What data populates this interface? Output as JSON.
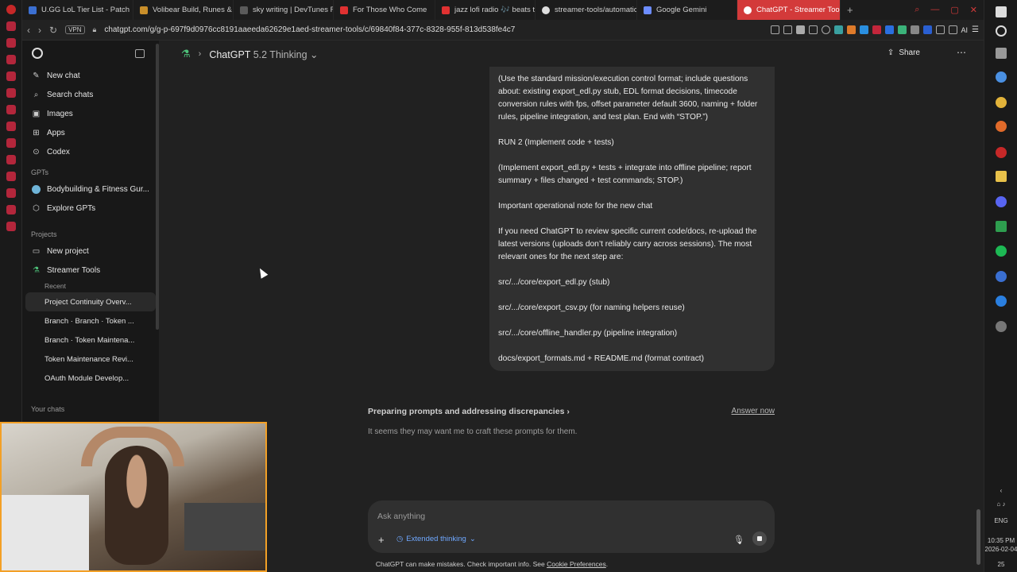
{
  "browser": {
    "tabs": [
      {
        "title": "U.GG LoL Tier List - Patch",
        "color": "#3b6fd1"
      },
      {
        "title": "Volibear Build, Runes & Co",
        "color": "#c98f2a"
      },
      {
        "title": "sky writing | DevTunes FM",
        "color": "#5a5a5a"
      },
      {
        "title": "For Those Who Come",
        "color": "#e03131"
      },
      {
        "title": "jazz lofi radio 🎶 beats to",
        "color": "#e03131"
      },
      {
        "title": "streamer-tools/automatic",
        "color": "#dddddd"
      },
      {
        "title": "Google Gemini",
        "color": "#6c8cff"
      },
      {
        "title": "ChatGPT - Streamer Tools",
        "color": "#ffffff",
        "active": true
      }
    ],
    "vpn_label": "VPN",
    "url": "chatgpt.com/g/g-p-697f9d0976cc8191aaeeda62629e1aed-streamer-tools/c/69840f84-377c-8328-955f-813d538fe4c7",
    "ai_label": "AI",
    "tray": {
      "lang": "ENG",
      "time": "10:35 PM",
      "date": "2026-02-04",
      "badge": "25"
    }
  },
  "sidebar": {
    "top_items": [
      {
        "label": "New chat",
        "icon": "pencil-icon"
      },
      {
        "label": "Search chats",
        "icon": "search-icon"
      },
      {
        "label": "Images",
        "icon": "image-icon"
      },
      {
        "label": "Apps",
        "icon": "apps-icon"
      },
      {
        "label": "Codex",
        "icon": "codex-icon"
      }
    ],
    "gpts_label": "GPTs",
    "gpts": [
      {
        "label": "Bodybuilding & Fitness Gur...",
        "icon": "gpt-avatar-icon"
      },
      {
        "label": "Explore GPTs",
        "icon": "explore-icon"
      }
    ],
    "projects_label": "Projects",
    "projects": [
      {
        "label": "New project",
        "icon": "folder-plus-icon"
      },
      {
        "label": "Streamer Tools",
        "icon": "flask-icon"
      }
    ],
    "recent_label": "Recent",
    "recent": [
      "Project Continuity Overv...",
      "Branch · Branch · Token ...",
      "Branch · Token Maintena...",
      "Token Maintenance Revi...",
      "OAuth Module Develop..."
    ],
    "hidden_label": "Your chats"
  },
  "header": {
    "model_name": "ChatGPT",
    "model_version": "5.2 Thinking",
    "share_label": "Share"
  },
  "message": {
    "paragraphs": [
      "(Use the standard mission/execution control format; include questions about: existing export_edl.py stub, EDL format decisions, timecode conversion rules with fps, offset parameter default 3600, naming + folder rules, pipeline integration, and test plan. End with “STOP.”)",
      "RUN 2 (Implement code + tests)",
      "(Implement export_edl.py + tests + integrate into offline pipeline; report summary + files changed + test commands; STOP.)",
      "Important operational note for the new chat",
      "If you need ChatGPT to review specific current code/docs, re-upload the latest versions (uploads don’t reliably carry across sessions). The most relevant ones for the next step are:",
      "src/.../core/export_edl.py (stub)",
      "src/.../core/export_csv.py (for naming helpers reuse)",
      "src/.../core/offline_handler.py (pipeline integration)",
      "docs/export_formats.md + README.md (format contract)"
    ]
  },
  "thinking": {
    "heading": "Preparing prompts and addressing discrepancies",
    "answer_now": "Answer now",
    "status": "It seems they may want me to craft these prompts for them."
  },
  "composer": {
    "placeholder": "Ask anything",
    "mode_label": "Extended thinking"
  },
  "footer": {
    "text": "ChatGPT can make mistakes. Check important info. See",
    "link": "Cookie Preferences",
    "suffix": "."
  },
  "colors": {
    "accent": "#d33a3a",
    "thinking_blue": "#6fa8ff",
    "project_green": "#4ec27a",
    "webcam_border": "#f3a026"
  }
}
